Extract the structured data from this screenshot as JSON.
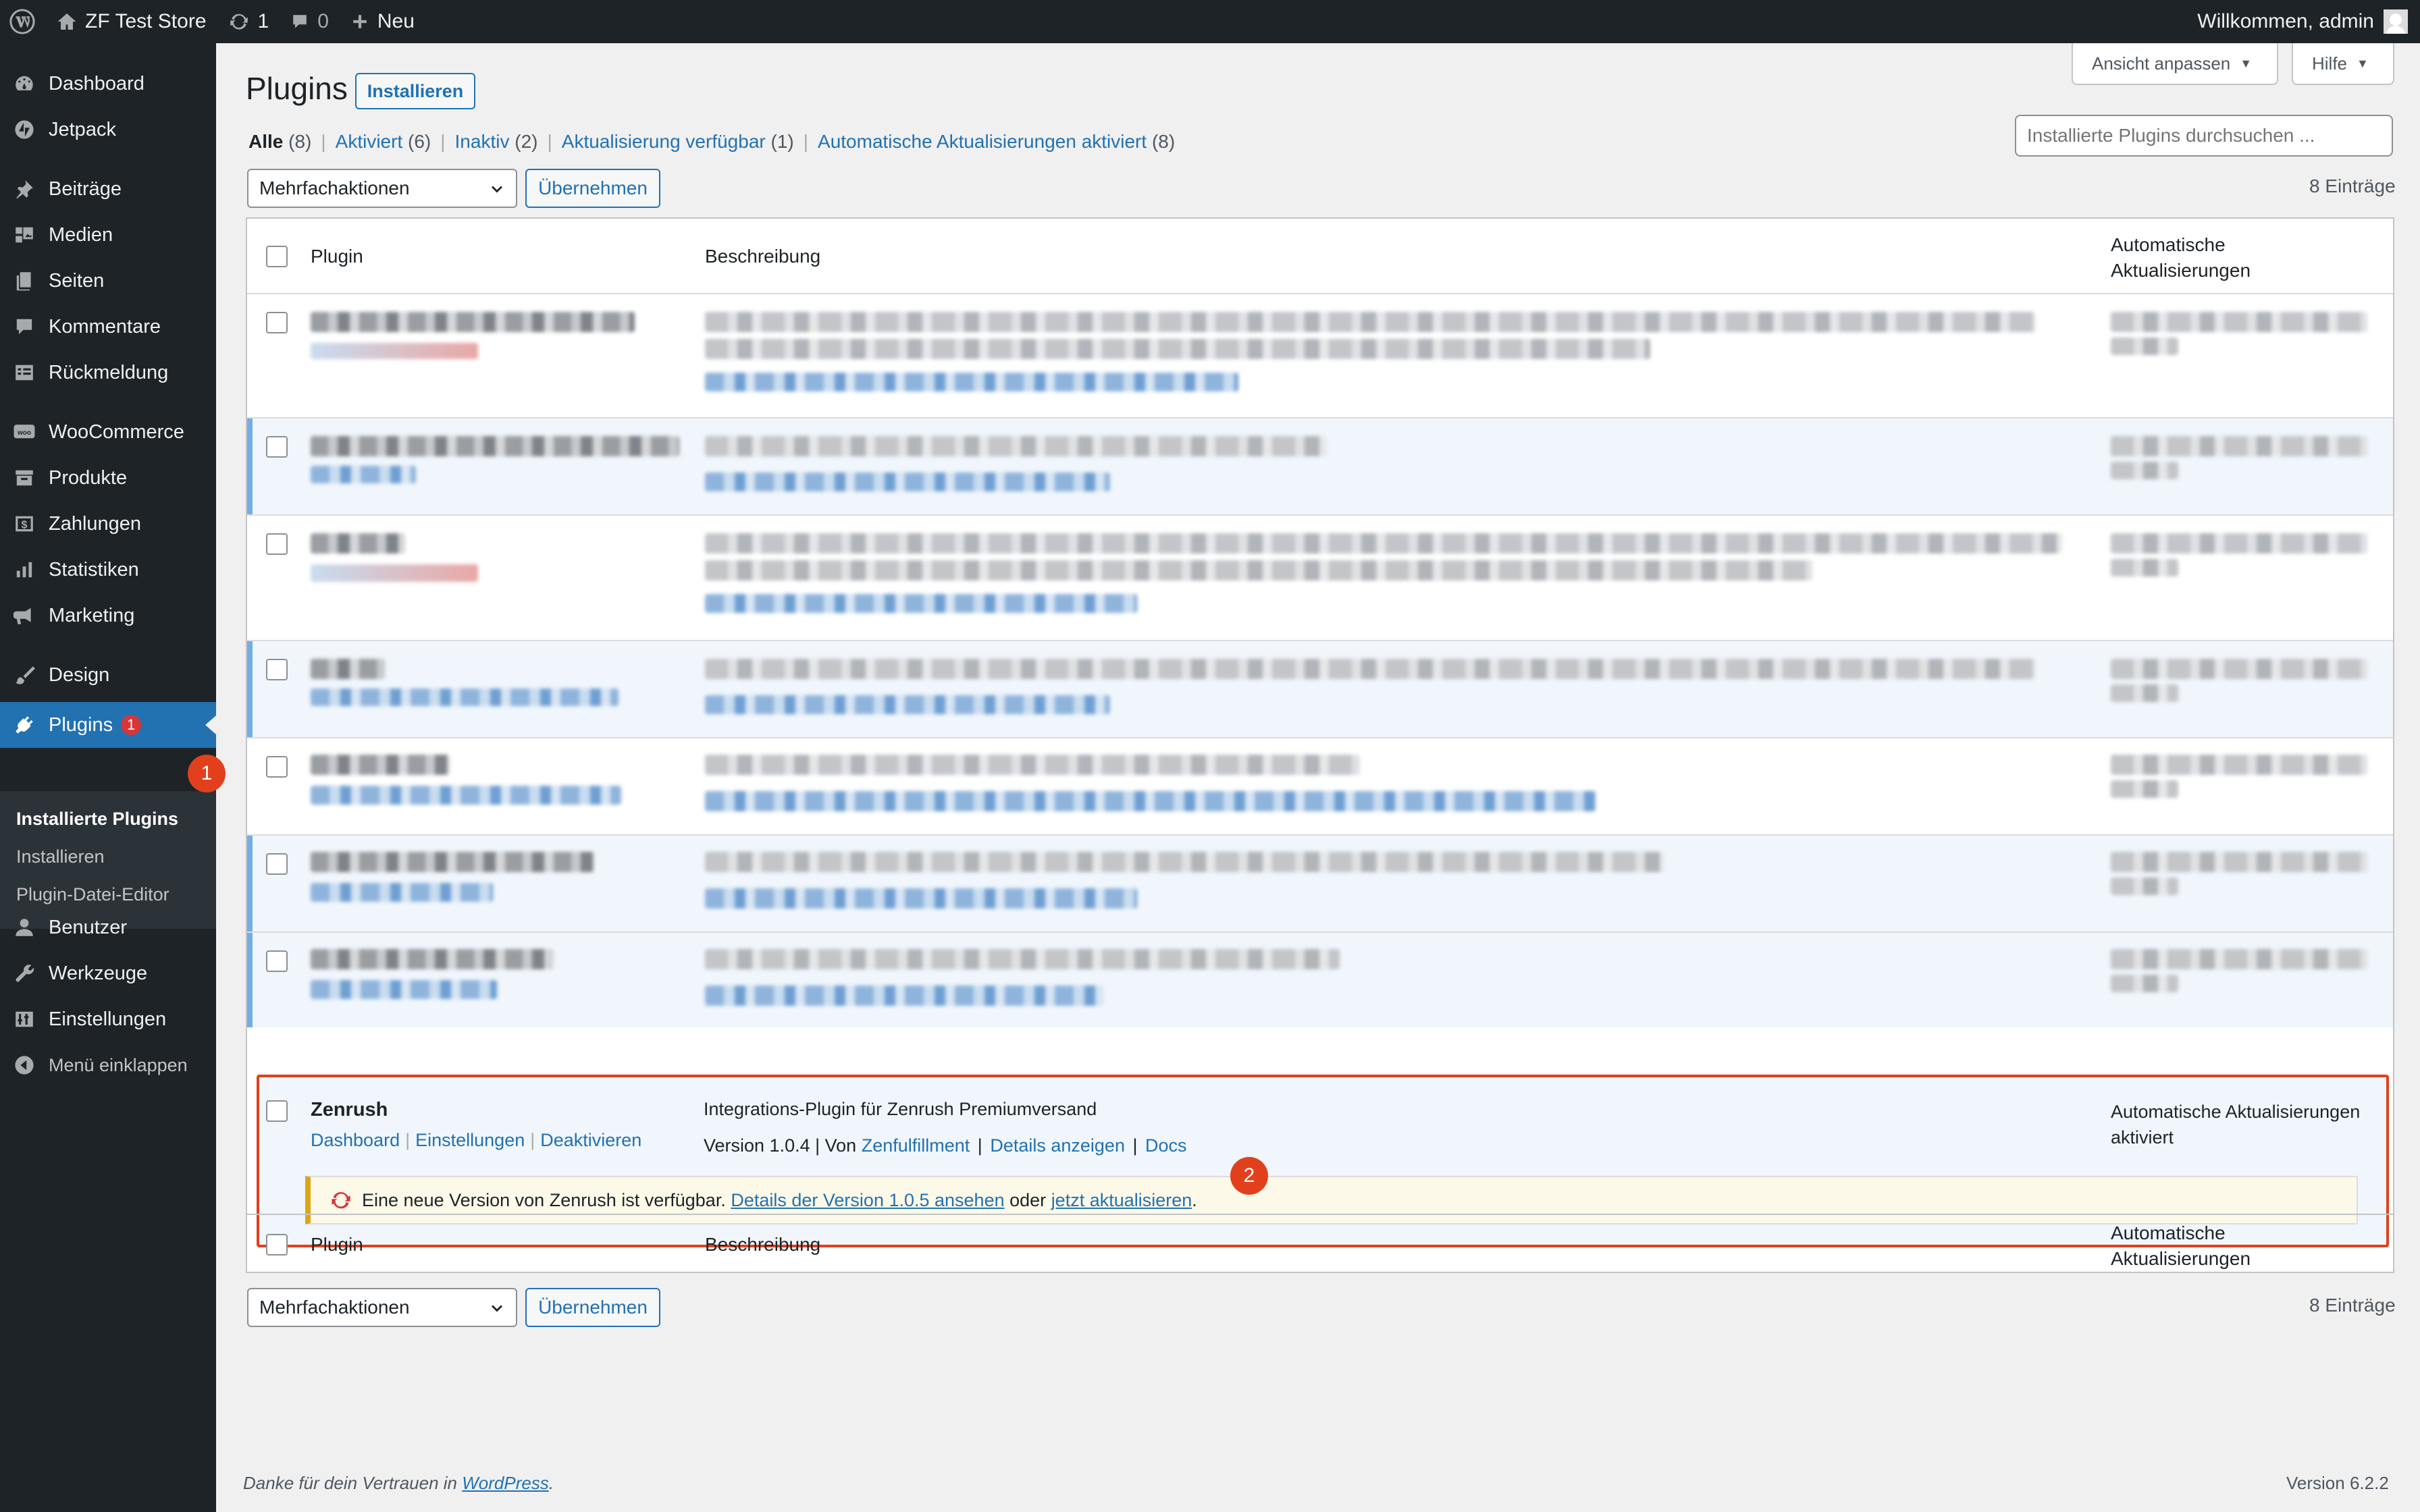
{
  "admin_bar": {
    "site_name": "ZF Test Store",
    "updates_count": "1",
    "comments_count": "0",
    "new_label": "Neu",
    "welcome": "Willkommen, admin"
  },
  "sidebar": {
    "items": [
      {
        "label": "Dashboard",
        "icon": "dashboard-icon"
      },
      {
        "label": "Jetpack",
        "icon": "jetpack-icon"
      },
      {
        "label": "Beiträge",
        "icon": "pin-icon"
      },
      {
        "label": "Medien",
        "icon": "media-icon"
      },
      {
        "label": "Seiten",
        "icon": "page-icon"
      },
      {
        "label": "Kommentare",
        "icon": "comment-icon"
      },
      {
        "label": "Rückmeldung",
        "icon": "feedback-icon"
      },
      {
        "label": "WooCommerce",
        "icon": "woocommerce-icon"
      },
      {
        "label": "Produkte",
        "icon": "archive-icon"
      },
      {
        "label": "Zahlungen",
        "icon": "payment-icon"
      },
      {
        "label": "Statistiken",
        "icon": "chart-icon"
      },
      {
        "label": "Marketing",
        "icon": "megaphone-icon"
      },
      {
        "label": "Design",
        "icon": "brush-icon"
      },
      {
        "label": "Plugins",
        "icon": "plugin-icon",
        "badge": "1"
      },
      {
        "label": "Benutzer",
        "icon": "user-icon"
      },
      {
        "label": "Werkzeuge",
        "icon": "wrench-icon"
      },
      {
        "label": "Einstellungen",
        "icon": "settings-icon"
      },
      {
        "label": "Menü einklappen",
        "icon": "collapse-icon"
      }
    ],
    "submenu": [
      "Installierte Plugins",
      "Installieren",
      "Plugin-Datei-Editor"
    ]
  },
  "markers": {
    "one": "1",
    "two": "2"
  },
  "header": {
    "screen_options": "Ansicht anpassen",
    "help": "Hilfe",
    "title": "Plugins",
    "add_new": "Installieren"
  },
  "filters": {
    "all": "Alle",
    "all_count": "(8)",
    "active": "Aktiviert",
    "active_count": "(6)",
    "inactive": "Inaktiv",
    "inactive_count": "(2)",
    "update": "Aktualisierung verfügbar",
    "update_count": "(1)",
    "auto": "Automatische Aktualisierungen aktiviert",
    "auto_count": "(8)"
  },
  "search": {
    "placeholder": "Installierte Plugins durchsuchen ..."
  },
  "bulk": {
    "select_value": "Mehrfachaktionen",
    "apply": "Übernehmen",
    "count": "8 Einträge"
  },
  "table": {
    "col_plugin": "Plugin",
    "col_description": "Beschreibung",
    "col_auto_line1": "Automatische",
    "col_auto_line2": "Aktualisierungen"
  },
  "zenrush": {
    "name": "Zenrush",
    "actions": [
      "Dashboard",
      "Einstellungen",
      "Deaktivieren"
    ],
    "description": "Integrations-Plugin für Zenrush Premiumversand",
    "version": "Version 1.0.4 | Von",
    "author": "Zenfulfillment",
    "details": "Details anzeigen",
    "docs": "Docs",
    "auto_line1": "Automatische Aktualisierungen",
    "auto_line2": "aktiviert",
    "notice_text": "Eine neue Version von Zenrush ist verfügbar.",
    "notice_link1": "Details der Version 1.0.5 ansehen",
    "notice_or": "oder",
    "notice_link2": "jetzt aktualisieren",
    "notice_end": "."
  },
  "footer": {
    "thanks": "Danke für dein Vertrauen in",
    "wordpress": "WordPress",
    "period": ".",
    "version": "Version 6.2.2"
  }
}
